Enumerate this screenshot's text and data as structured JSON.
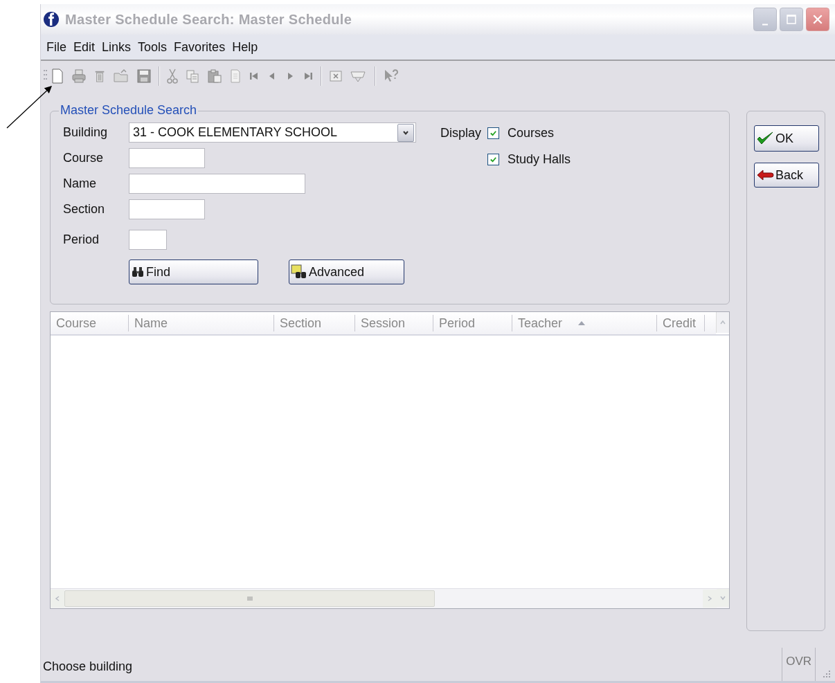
{
  "window": {
    "title": "Master Schedule Search: Master Schedule"
  },
  "menu": [
    "File",
    "Edit",
    "Links",
    "Tools",
    "Favorites",
    "Help"
  ],
  "search_group": {
    "title": "Master Schedule Search",
    "fields": [
      {
        "label": "Building",
        "kind": "dropdown",
        "value": "31 - COOK ELEMENTARY SCHOOL"
      },
      {
        "label": "Course",
        "kind": "text"
      },
      {
        "label": "Name",
        "kind": "text"
      },
      {
        "label": "Section",
        "kind": "text"
      },
      {
        "label": "Period",
        "kind": "text"
      }
    ],
    "display_label": "Display",
    "display_options": [
      {
        "label": "Courses",
        "checked": true
      },
      {
        "label": "Study Halls",
        "checked": true
      }
    ],
    "buttons": [
      {
        "label": "Find",
        "kind": "find"
      },
      {
        "label": "Advanced",
        "kind": "advanced"
      }
    ]
  },
  "grid": {
    "columns": [
      {
        "label": "Course",
        "sorted": false
      },
      {
        "label": "Name",
        "sorted": false
      },
      {
        "label": "Section",
        "sorted": false
      },
      {
        "label": "Session",
        "sorted": false
      },
      {
        "label": "Period",
        "sorted": false
      },
      {
        "label": "Teacher",
        "sorted": true
      },
      {
        "label": "Credit",
        "sorted": false
      }
    ]
  },
  "dialog_buttons": [
    {
      "label": "OK",
      "kind": "ok"
    },
    {
      "label": "Back",
      "kind": "back"
    }
  ],
  "status_bar": {
    "message": "Choose building",
    "indicator": "OVR"
  }
}
